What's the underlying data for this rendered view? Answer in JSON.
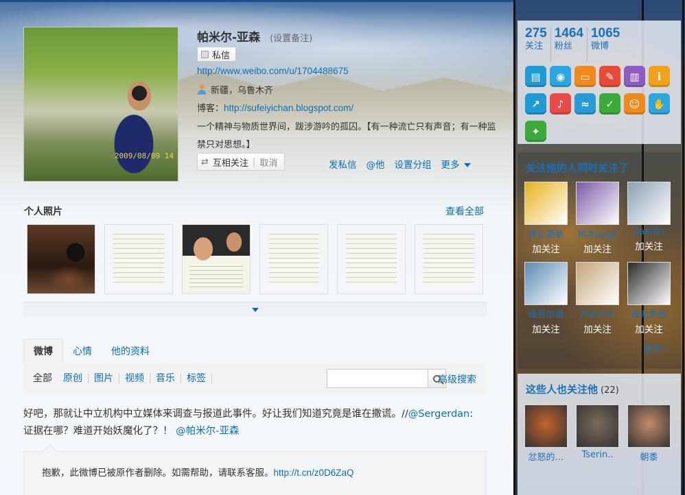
{
  "profile": {
    "name": "帕米尔-亚森",
    "remark_link": "(设置备注)",
    "message_button": "私信",
    "url": "http://www.weibo.com/u/1704488675",
    "location": "新疆，乌鲁木齐",
    "blog_label": "博客：",
    "blog_url": "http://sufeiyichan.blogspot.com/",
    "bio": "一个精神与物质世界间，跋涉游吟的孤囚。【有一种流亡只有声音；有一种监禁只对思想。】",
    "avatar_date": "2009/08/09 14",
    "follow_status": "互相关注",
    "follow_cancel": "取消",
    "actions": [
      "发私信",
      "@他",
      "设置分组",
      "更多"
    ]
  },
  "photos": {
    "title": "个人照片",
    "view_all": "查看全部"
  },
  "tabs": [
    "微博",
    "心情",
    "他的资料"
  ],
  "filters": [
    "全部",
    "原创",
    "图片",
    "视频",
    "音乐",
    "标签"
  ],
  "search": {
    "advanced": "高级搜索"
  },
  "feed": {
    "text_before": "好吧，那就让中立机构中立媒体来调查与报道此事件。好让我们知道究竟是谁在撒谎。//",
    "mention1": "@Sergerdan",
    "text_middle": ": 证据在哪？难道开始妖魔化了？！ ",
    "mention2": "@帕米尔-亚森",
    "repost_text": "抱歉，此微博已被原作者删除。如需帮助，请联系客服。",
    "repost_link": "http://t.cn/z0D6ZaQ"
  },
  "stats": [
    {
      "num": "275",
      "label": "关注"
    },
    {
      "num": "1464",
      "label": "粉丝"
    },
    {
      "num": "1065",
      "label": "微博"
    }
  ],
  "apps": [
    {
      "icon": "list-app-icon",
      "color": "#1e9ad6",
      "glyph": "▤"
    },
    {
      "icon": "weibo-app-icon",
      "color": "#2aa6e0",
      "glyph": "◉"
    },
    {
      "icon": "card-app-icon",
      "color": "#f08a1c",
      "glyph": "▭"
    },
    {
      "icon": "article-app-icon",
      "color": "#e84a3a",
      "glyph": "✎"
    },
    {
      "icon": "chart-app-icon",
      "color": "#8e5bc4",
      "glyph": "▥"
    },
    {
      "icon": "info-app-icon",
      "color": "#f2a21a",
      "glyph": "i"
    },
    {
      "icon": "share-app-icon",
      "color": "#1e9ad6",
      "glyph": "↗"
    },
    {
      "icon": "mic-app-icon",
      "color": "#e84a4a",
      "glyph": "♪"
    },
    {
      "icon": "wave-app-icon",
      "color": "#2a9ad6",
      "glyph": "≈"
    },
    {
      "icon": "like-app-icon",
      "color": "#3aaa3a",
      "glyph": "✓"
    },
    {
      "icon": "smile-app-icon",
      "color": "#f08a1c",
      "glyph": "☺"
    },
    {
      "icon": "hand-app-icon",
      "color": "#2aa6e0",
      "glyph": "✋"
    },
    {
      "icon": "game-app-icon",
      "color": "#3aaa3a",
      "glyph": "✦"
    }
  ],
  "common_follows": {
    "title": "关注他的人同时关注了",
    "users": [
      {
        "name": "停止更新",
        "follow": "加关注",
        "color": "#e6b21a"
      },
      {
        "name": "柯木uygh",
        "follow": "加关注",
        "color": "#7a5aa4"
      },
      {
        "name": "Saerdn",
        "follow": "加关注",
        "color": "#8aa0b4"
      },
      {
        "name": "维吾尔语",
        "follow": "加关注",
        "color": "#5a8ab4"
      },
      {
        "name": "PHILO今",
        "follow": "加关注",
        "color": "#c4a47a"
      },
      {
        "name": "救助声他",
        "follow": "加关注",
        "color": "#2a2a2a"
      }
    ],
    "more": "更多»"
  },
  "also_follow": {
    "title": "这些人也关注他",
    "count": "(22)",
    "users": [
      {
        "name": "忿怒的…",
        "color": "#c4622a"
      },
      {
        "name": "Tserin..",
        "color": "#7a6a5a"
      },
      {
        "name": "朝黍",
        "color": "#c48a6a"
      }
    ]
  }
}
